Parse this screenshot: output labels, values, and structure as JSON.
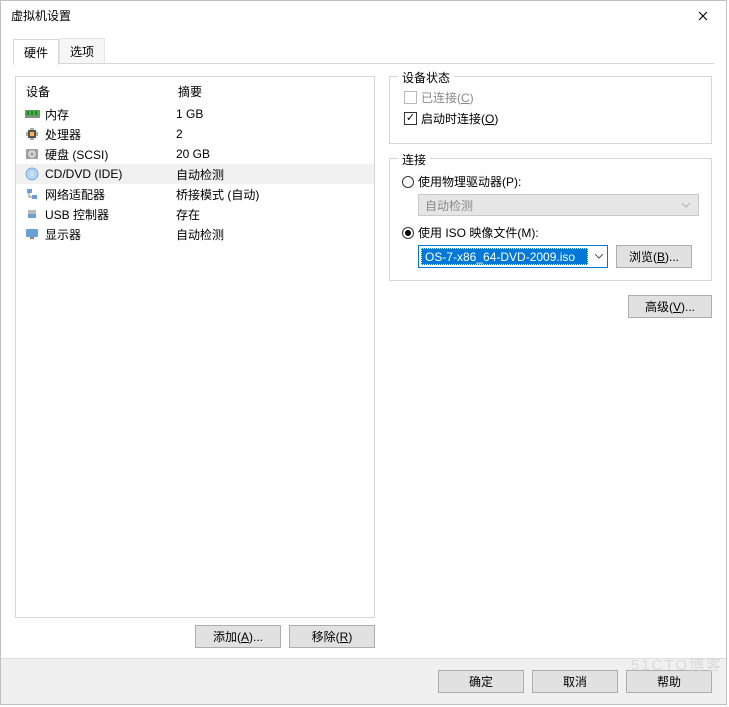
{
  "title": "虚拟机设置",
  "tabs": {
    "hardware": "硬件",
    "options": "选项"
  },
  "list": {
    "headers": {
      "device": "设备",
      "summary": "摘要"
    },
    "items": [
      {
        "name": "内存",
        "summary": "1 GB",
        "icon": "memory"
      },
      {
        "name": "处理器",
        "summary": "2",
        "icon": "cpu"
      },
      {
        "name": "硬盘 (SCSI)",
        "summary": "20 GB",
        "icon": "disk"
      },
      {
        "name": "CD/DVD (IDE)",
        "summary": "自动检测",
        "icon": "cd",
        "selected": true
      },
      {
        "name": "网络适配器",
        "summary": "桥接模式 (自动)",
        "icon": "net"
      },
      {
        "name": "USB 控制器",
        "summary": "存在",
        "icon": "usb"
      },
      {
        "name": "显示器",
        "summary": "自动检测",
        "icon": "monitor"
      }
    ],
    "add": "添加(A)...",
    "remove": "移除(R)"
  },
  "status": {
    "group": "设备状态",
    "connected": "已连接(C)",
    "connectAtPowerOn": "启动时连接(O)"
  },
  "connection": {
    "group": "连接",
    "physical": "使用物理驱动器(P):",
    "autoDetect": "自动检测",
    "iso": "使用 ISO 映像文件(M):",
    "isoValue": "OS-7-x86_64-DVD-2009.iso",
    "browse": "浏览(B)..."
  },
  "advanced": "高级(V)...",
  "footer": {
    "ok": "确定",
    "cancel": "取消",
    "help": "帮助"
  },
  "watermark": "51CTO博客"
}
